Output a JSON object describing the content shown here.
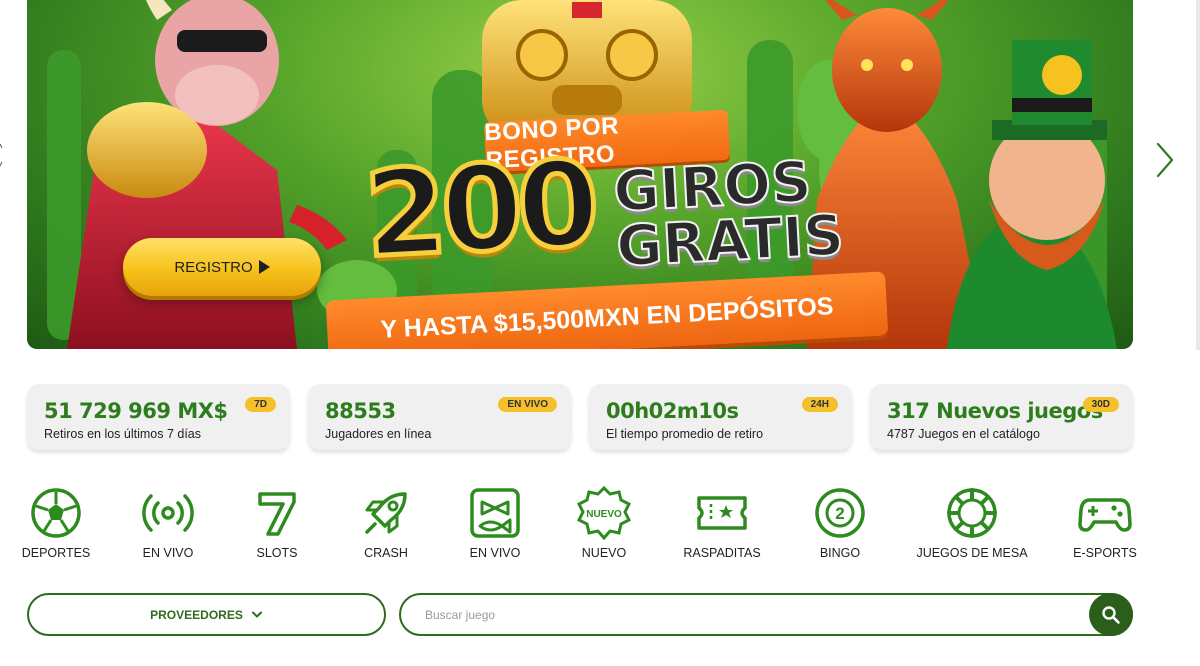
{
  "banner": {
    "register_button": "REGISTRO",
    "promo_top": "BONO POR REGISTRO",
    "promo_number": "200",
    "promo_line1": "GIROS",
    "promo_line2": "GRATIS",
    "promo_bottom": "Y HASTA $15,500MXN EN DEPÓSITOS",
    "next_icon": "chevron-right-icon"
  },
  "stats": [
    {
      "value": "51 729 969 MX$",
      "label": "Retiros en los últimos 7 días",
      "badge": "7D"
    },
    {
      "value": "88553",
      "label": "Jugadores en línea",
      "badge": "EN VIVO"
    },
    {
      "value": "00h02m10s",
      "label": "El tiempo promedio de retiro",
      "badge": "24H"
    },
    {
      "value": "317 Nuevos juegos",
      "label": "4787 Juegos en el catálogo",
      "badge": "30D"
    }
  ],
  "categories": [
    {
      "label": "DEPORTES",
      "icon": "soccer-ball-icon"
    },
    {
      "label": "EN VIVO",
      "icon": "broadcast-icon"
    },
    {
      "label": "SLOTS",
      "icon": "seven-icon"
    },
    {
      "label": "CRASH",
      "icon": "rocket-icon"
    },
    {
      "label": "EN VIVO",
      "icon": "live-game-icon"
    },
    {
      "label": "NUEVO",
      "icon": "new-badge-icon",
      "badge_text": "NUEVO"
    },
    {
      "label": "RASPADITAS",
      "icon": "scratch-ticket-icon"
    },
    {
      "label": "BINGO",
      "icon": "bingo-ball-icon",
      "badge_text": "2"
    },
    {
      "label": "JUEGOS DE MESA",
      "icon": "poker-chip-icon"
    },
    {
      "label": "E-SPORTS",
      "icon": "gamepad-icon"
    }
  ],
  "controls": {
    "providers_label": "PROVEEDORES",
    "search_placeholder": "Buscar juego"
  },
  "colors": {
    "brand_green": "#2e7d1d",
    "dark_green": "#2a5e1a",
    "badge_yellow": "#f5c02a",
    "promo_orange": "#f26a12"
  }
}
